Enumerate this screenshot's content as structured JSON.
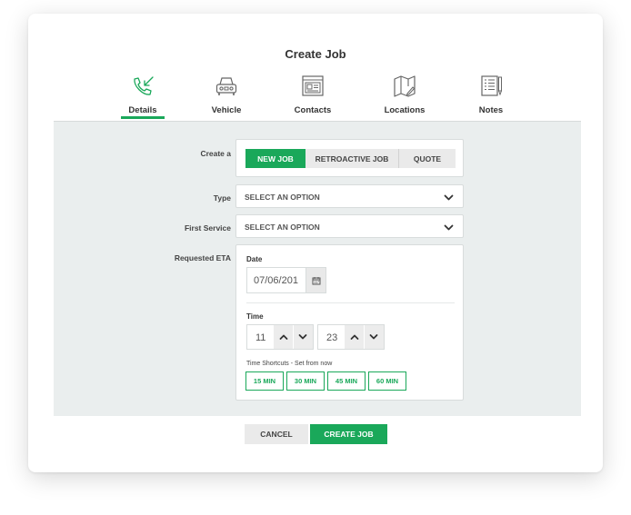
{
  "title": "Create Job",
  "tabs": [
    {
      "label": "Details",
      "icon": "phone-arrow-icon",
      "active": true
    },
    {
      "label": "Vehicle",
      "icon": "car-icon",
      "active": false
    },
    {
      "label": "Contacts",
      "icon": "contact-card-icon",
      "active": false
    },
    {
      "label": "Locations",
      "icon": "map-icon",
      "active": false
    },
    {
      "label": "Notes",
      "icon": "notes-icon",
      "active": false
    }
  ],
  "form": {
    "create_a": {
      "label": "Create a",
      "options": [
        "NEW JOB",
        "RETROACTIVE JOB",
        "QUOTE"
      ],
      "selected": "NEW JOB"
    },
    "type": {
      "label": "Type",
      "value": "SELECT AN OPTION"
    },
    "first_service": {
      "label": "First Service",
      "value": "SELECT AN OPTION"
    },
    "requested_eta": {
      "label": "Requested ETA",
      "date_label": "Date",
      "date_value": "07/06/201",
      "time_label": "Time",
      "hour": "11",
      "minute": "23",
      "shortcuts_label": "Time Shortcuts - Set from now",
      "shortcuts": [
        "15 MIN",
        "30 MIN",
        "45 MIN",
        "60 MIN"
      ]
    }
  },
  "actions": {
    "cancel": "CANCEL",
    "create": "CREATE JOB"
  },
  "colors": {
    "accent": "#1aa85a",
    "panel_bg": "#eaeeee",
    "icon_stroke": "#666666"
  }
}
